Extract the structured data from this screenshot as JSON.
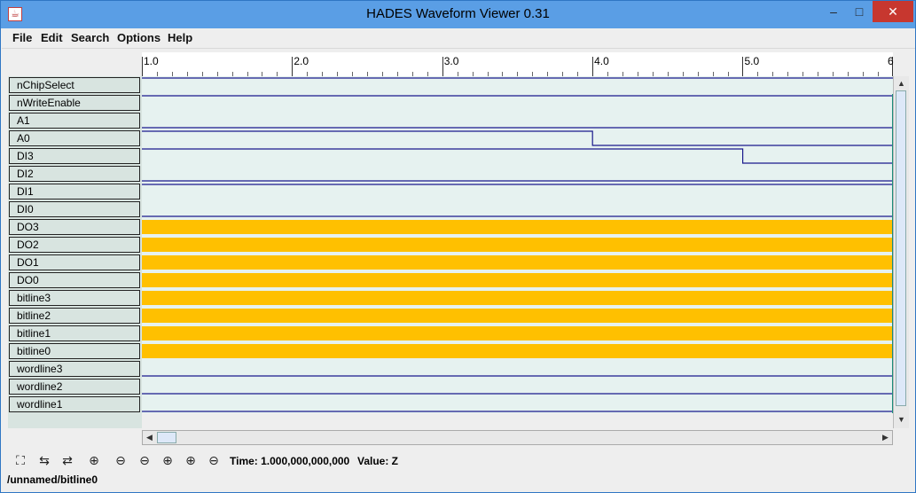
{
  "window": {
    "title": "HADES Waveform Viewer 0.31",
    "app_icon": "java-icon",
    "minimize": "–",
    "maximize": "□",
    "close": "✕"
  },
  "menu": [
    {
      "label": "File"
    },
    {
      "label": "Edit"
    },
    {
      "label": "Search"
    },
    {
      "label": "Options"
    },
    {
      "label": "Help"
    }
  ],
  "ruler": {
    "labels": [
      "1.0",
      "2.0",
      "3.0",
      "4.0",
      "5.0",
      "6"
    ],
    "range": [
      1.0,
      6.0
    ]
  },
  "signals": [
    {
      "name": "nChipSelect",
      "type": "bit",
      "value": 1,
      "transitions": []
    },
    {
      "name": "nWriteEnable",
      "type": "bit",
      "value": 1,
      "transitions": []
    },
    {
      "name": "A1",
      "type": "bit",
      "value": 0,
      "transitions": []
    },
    {
      "name": "A0",
      "type": "bit",
      "value": 1,
      "transitions": [
        [
          4.0,
          0
        ]
      ]
    },
    {
      "name": "DI3",
      "type": "bit",
      "value": 1,
      "transitions": [
        [
          5.0,
          0
        ]
      ]
    },
    {
      "name": "DI2",
      "type": "bit",
      "value": 0,
      "transitions": []
    },
    {
      "name": "DI1",
      "type": "bit",
      "value": 1,
      "transitions": []
    },
    {
      "name": "DI0",
      "type": "bit",
      "value": 0,
      "transitions": []
    },
    {
      "name": "DO3",
      "type": "undefined",
      "value": "Z",
      "transitions": []
    },
    {
      "name": "DO2",
      "type": "undefined",
      "value": "Z",
      "transitions": []
    },
    {
      "name": "DO1",
      "type": "undefined",
      "value": "Z",
      "transitions": []
    },
    {
      "name": "DO0",
      "type": "undefined",
      "value": "Z",
      "transitions": []
    },
    {
      "name": "bitline3",
      "type": "undefined",
      "value": "Z",
      "transitions": []
    },
    {
      "name": "bitline2",
      "type": "undefined",
      "value": "Z",
      "transitions": []
    },
    {
      "name": "bitline1",
      "type": "undefined",
      "value": "Z",
      "transitions": []
    },
    {
      "name": "bitline0",
      "type": "undefined",
      "value": "Z",
      "transitions": []
    },
    {
      "name": "wordline3",
      "type": "bit",
      "value": 0,
      "transitions": []
    },
    {
      "name": "wordline2",
      "type": "bit",
      "value": 0,
      "transitions": []
    },
    {
      "name": "wordline1",
      "type": "bit",
      "value": 0,
      "transitions": []
    }
  ],
  "colors": {
    "wave_bg": "#e6f2f0",
    "wave_line": "#1a1a8c",
    "undefined_fill": "#ffc000",
    "name_bg": "#d8e4e0"
  },
  "toolbar": {
    "icons": [
      "zoom-fit-icon",
      "zoom-region-icon",
      "zoom-prev-icon",
      "zoom-in-icon",
      "zoom-out-icon",
      "zoom-out-2-icon",
      "zoom-in-2-icon",
      "zoom-in-3-icon",
      "zoom-out-3-icon"
    ],
    "time_label": "Time: 1.000,000,000,000",
    "value_label": "Value: Z"
  },
  "status": {
    "path": "/unnamed/bitline0"
  }
}
